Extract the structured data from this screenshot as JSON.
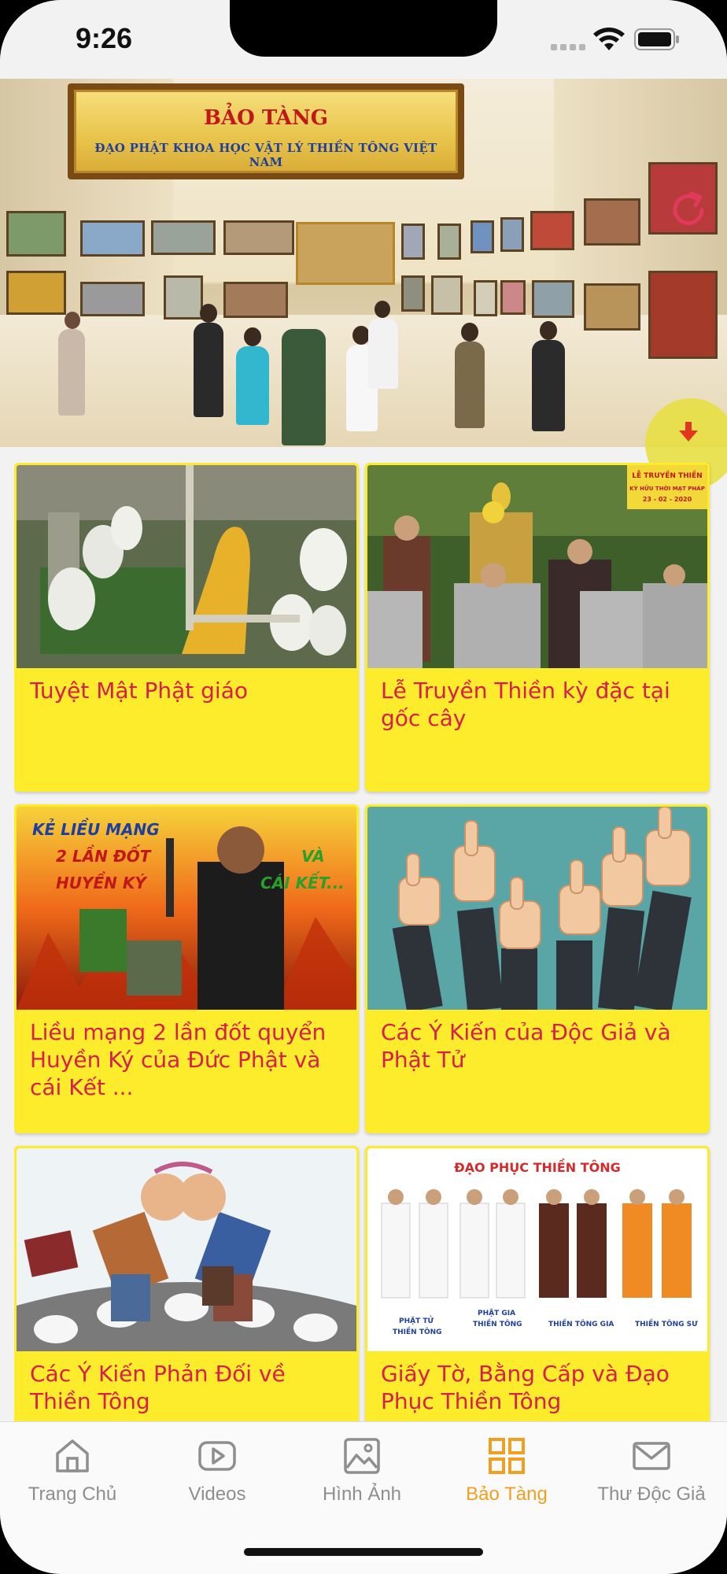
{
  "status_bar": {
    "time": "9:26"
  },
  "hero": {
    "sign_line1": "BẢO TÀNG",
    "sign_line2": "ĐẠO PHẬT KHOA HỌC VẬT LÝ THIỀN TÔNG VIỆT NAM",
    "refresh_icon": "refresh-icon",
    "down_icon": "arrow-down-icon"
  },
  "cards": [
    {
      "title": "Tuyệt Mật Phật giáo"
    },
    {
      "title": "Lễ Truyền Thiền kỳ đặc tại gốc cây",
      "badge_line1": "LỄ TRUYỀN THIỀN",
      "badge_line2": "KỲ HỮU THỜI MẠT PHÁP",
      "badge_date": "23 - 02 - 2020"
    },
    {
      "title": "Liều mạng 2 lần đốt quyển Huyền Ký của Đức Phật và cái Kết ...",
      "overlay_left": "KẺ LIỀU MẠNG\n2 LẦN ĐỐT\nHUYỀN KÝ",
      "overlay_right": "VÀ\nCÁI KẾT..."
    },
    {
      "title": "Các Ý Kiến của Độc Giả và Phật Tử"
    },
    {
      "title": "Các Ý Kiến Phản Đối về Thiền Tông"
    },
    {
      "title": "Giấy Tờ, Bằng Cấp và Đạo Phục Thiền Tông",
      "poster_title": "ĐẠO PHỤC THIỀN TÔNG",
      "poster_labels": [
        "PHẬT TỬ\nTHIỀN TÔNG",
        "PHẬT GIA\nTHIỀN TÔNG",
        "THIỀN TÔNG GIA",
        "THIỀN TÔNG SƯ"
      ]
    }
  ],
  "tabbar": {
    "tabs": [
      {
        "label": "Trang Chủ",
        "icon": "home-icon"
      },
      {
        "label": "Videos",
        "icon": "play-icon"
      },
      {
        "label": "Hình Ảnh",
        "icon": "image-icon"
      },
      {
        "label": "Bảo Tàng",
        "icon": "grid-icon",
        "active": true
      },
      {
        "label": "Thư Độc Giả",
        "icon": "mail-icon"
      }
    ]
  },
  "colors": {
    "card_bg": "#fdec2c",
    "title": "#d81e4b",
    "active_tab": "#f0a020",
    "inactive_tab": "#8e8e8e"
  }
}
